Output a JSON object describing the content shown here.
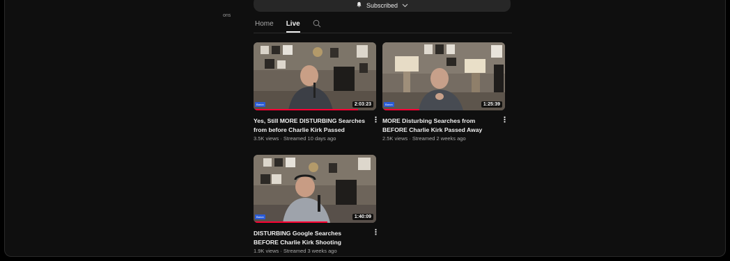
{
  "channel": {
    "side_text": "ons",
    "subscribe_label": "Subscribed",
    "bell_icon": "bell-icon",
    "chevron_icon": "chevron-down-icon"
  },
  "tabs": [
    {
      "label": "Home",
      "active": false
    },
    {
      "label": "Live",
      "active": true
    }
  ],
  "search_icon": "search-icon",
  "videos": [
    {
      "title": "Yes, Still MORE DISTURBING Searches from before Charlie Kirk Passed",
      "views": "3.5K views",
      "streamed": "Streamed 10 days ago",
      "stats": "3.5K views · Streamed 10 days ago",
      "duration": "2:03:23",
      "progress": 0.85,
      "tag": "Baron"
    },
    {
      "title": "MORE Disturbing Searches from BEFORE Charlie Kirk Passed Away",
      "views": "2.5K views",
      "streamed": "Streamed 2 weeks ago",
      "stats": "2.5K views · Streamed 2 weeks ago",
      "duration": "1:25:39",
      "progress": 0.3,
      "tag": "Baron"
    },
    {
      "title": "DISTURBING Google Searches BEFORE Charlie Kirk Shooting",
      "views": "1.9K views",
      "streamed": "Streamed 3 weeks ago",
      "stats": "1.9K views · Streamed 3 weeks ago",
      "duration": "1:40:09",
      "progress": 0.6,
      "tag": "Baron"
    }
  ],
  "colors": {
    "background": "#0f0f0f",
    "text": "#f1f1f1",
    "secondary_text": "#aaaaaa",
    "progress": "#ff0033"
  }
}
